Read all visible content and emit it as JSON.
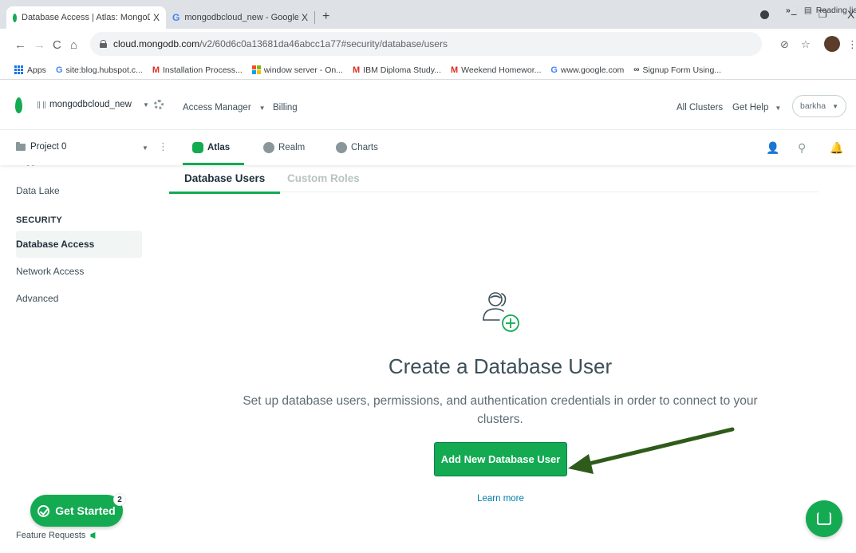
{
  "browser": {
    "tabs": [
      {
        "title": "Database Access | Atlas: MongoD",
        "close": "X",
        "active": true
      },
      {
        "title": "mongodbcloud_new - Google Se",
        "close": "X",
        "active": false
      }
    ],
    "new_tab": "+",
    "window_controls": {
      "minimize": "−",
      "restore": "▫",
      "close": "X"
    },
    "url_host": "cloud.mongodb.com",
    "url_path": "/v2/60d6c0a13681da46abcc1a77#security/database/users",
    "bookmarks": [
      {
        "label": "Apps",
        "icon": "apps-grid-icon"
      },
      {
        "label": "site:blog.hubspot.c...",
        "icon": "google-icon"
      },
      {
        "label": "Installation Process...",
        "icon": "gmail-icon"
      },
      {
        "label": "window server - On...",
        "icon": "windows-icon"
      },
      {
        "label": "IBM Diploma Study...",
        "icon": "gmail-icon"
      },
      {
        "label": "Weekend Homewor...",
        "icon": "gmail-icon"
      },
      {
        "label": "www.google.com",
        "icon": "google-icon"
      },
      {
        "label": "Signup Form Using...",
        "icon": "link-icon"
      }
    ],
    "bookmarks_overflow": "»",
    "reading_list": "Reading lis"
  },
  "atlas": {
    "org_name": "mongodbcloud_new",
    "top_nav": {
      "access_manager": "Access Manager",
      "billing": "Billing",
      "all_clusters": "All Clusters",
      "get_help": "Get Help",
      "user": "barkha"
    },
    "project_name": "Project 0",
    "product_tabs": [
      {
        "label": "Atlas",
        "active": true
      },
      {
        "label": "Realm",
        "active": false
      },
      {
        "label": "Charts",
        "active": false
      }
    ]
  },
  "sidebar": {
    "cut_item": "Triggers",
    "data_lake": "Data Lake",
    "security_heading": "SECURITY",
    "items": [
      {
        "label": "Database Access",
        "active": true
      },
      {
        "label": "Network Access",
        "active": false
      },
      {
        "label": "Advanced",
        "active": false
      }
    ]
  },
  "main": {
    "subtabs": [
      {
        "label": "Database Users",
        "active": true
      },
      {
        "label": "Custom Roles",
        "active": false
      }
    ],
    "empty_title": "Create a Database User",
    "empty_desc": "Set up database users, permissions, and authentication credentials in order to connect to your clusters.",
    "add_button": "Add New Database User",
    "learn_more": "Learn more"
  },
  "floating": {
    "get_started": "Get Started",
    "get_started_badge": "2",
    "feature_requests": "Feature Requests"
  },
  "colors": {
    "accent": "#13aa52",
    "arrow": "#2e5b1a",
    "link": "#007cad"
  }
}
